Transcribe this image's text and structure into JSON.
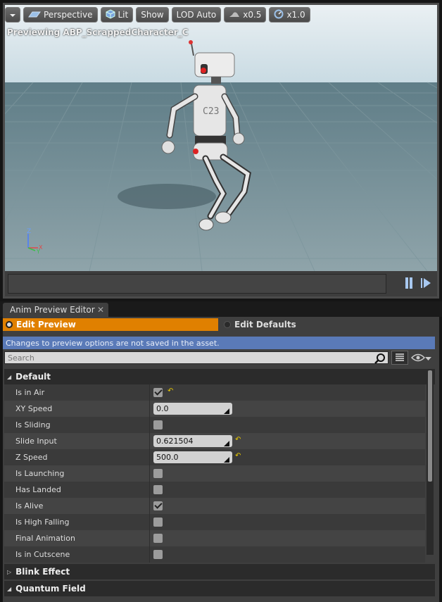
{
  "viewport": {
    "toolbar": {
      "menu_label": "",
      "perspective": "Perspective",
      "lit": "Lit",
      "show": "Show",
      "lod": "LOD Auto",
      "speed_slow": "x0.5",
      "speed_normal": "x1.0"
    },
    "preview_label": "Previewing ABP_ScrappedCharacter_C",
    "robot_chest_text": "C23",
    "axis": {
      "z": "Z",
      "x": "X",
      "y": "Y"
    }
  },
  "tab": {
    "label": "Anim Preview Editor",
    "close": "✕"
  },
  "modes": {
    "active": "Edit Preview",
    "inactive": "Edit Defaults"
  },
  "notice": "Changes to preview options are not saved in the asset.",
  "search": {
    "placeholder": "Search"
  },
  "categories": {
    "default": "Default",
    "blink": "Blink Effect",
    "quantum": "Quantum Field"
  },
  "properties": [
    {
      "name": "Is in Air",
      "type": "bool",
      "value": true,
      "reset": true
    },
    {
      "name": "XY Speed",
      "type": "float",
      "value": "0.0",
      "reset": false
    },
    {
      "name": "Is Sliding",
      "type": "bool",
      "value": false,
      "reset": false
    },
    {
      "name": "Slide Input",
      "type": "float",
      "value": "0.621504",
      "reset": true
    },
    {
      "name": "Z Speed",
      "type": "float",
      "value": "500.0",
      "reset": true
    },
    {
      "name": "Is Launching",
      "type": "bool",
      "value": false,
      "reset": false
    },
    {
      "name": "Has Landed",
      "type": "bool",
      "value": false,
      "reset": false
    },
    {
      "name": "Is Alive",
      "type": "bool",
      "value": true,
      "reset": false
    },
    {
      "name": "Is High Falling",
      "type": "bool",
      "value": false,
      "reset": false
    },
    {
      "name": "Final Animation",
      "type": "bool",
      "value": false,
      "reset": false
    },
    {
      "name": "Is in Cutscene",
      "type": "bool",
      "value": false,
      "reset": false
    }
  ],
  "colors": {
    "accent": "#e08000",
    "notice": "#5a7ab8",
    "reset_arrow": "#e8c800"
  }
}
